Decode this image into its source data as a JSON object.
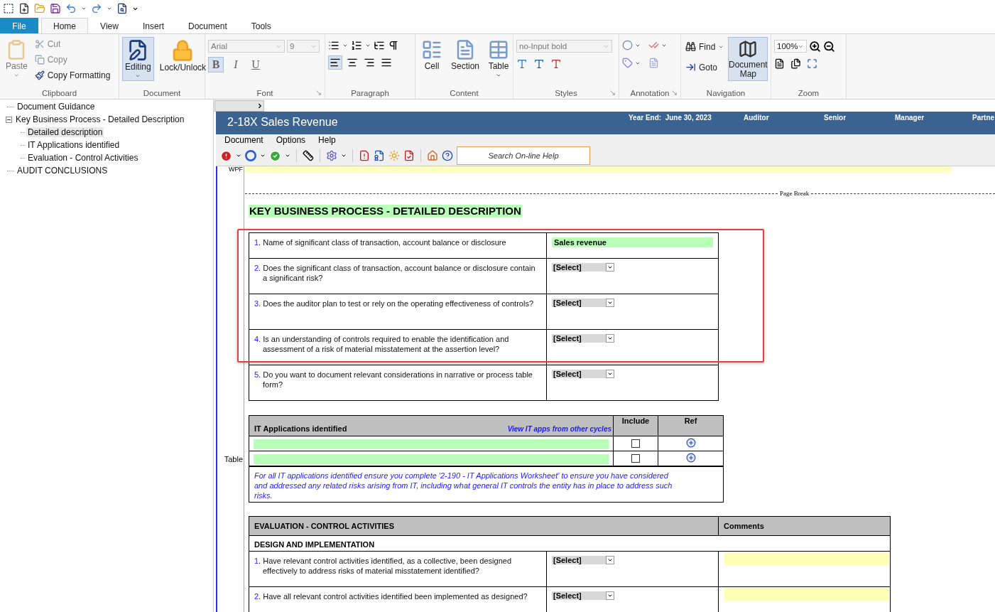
{
  "ribbon_tabs": [
    {
      "label": "File",
      "kind": "file",
      "selected": false
    },
    {
      "label": "Home",
      "kind": "tab",
      "selected": true
    },
    {
      "label": "View",
      "kind": "tab",
      "selected": false
    },
    {
      "label": "Insert",
      "kind": "tab",
      "selected": false
    },
    {
      "label": "Document",
      "kind": "tab",
      "selected": false
    },
    {
      "label": "Tools",
      "kind": "tab",
      "selected": false
    }
  ],
  "clipboard": {
    "label": "Clipboard",
    "paste": {
      "label": "Paste",
      "disabled": true
    },
    "cut": {
      "label": "Cut",
      "disabled": true
    },
    "copy": {
      "label": "Copy",
      "disabled": true
    },
    "copy_formatting": {
      "label": "Copy Formatting",
      "disabled": false
    }
  },
  "document_group": {
    "label": "Document",
    "editing": {
      "label": "Editing",
      "selected": true
    },
    "lock": {
      "label": "Lock/Unlock",
      "selected": false
    }
  },
  "font": {
    "label": "Font",
    "name": {
      "value": "Arial",
      "disabled": true
    },
    "size": {
      "value": "9",
      "disabled": true
    },
    "bold": {
      "label": "B",
      "selected": true
    },
    "italic": {
      "label": "I",
      "selected": false
    },
    "underline": {
      "label": "U",
      "selected": false
    }
  },
  "paragraph": {
    "label": "Paragraph",
    "alignments": [
      {
        "selected": true
      },
      {
        "selected": false
      },
      {
        "selected": false
      },
      {
        "selected": false
      }
    ]
  },
  "content": {
    "label": "Content",
    "buttons": [
      "Cell",
      "Section",
      "Table"
    ]
  },
  "styles": {
    "label": "Styles",
    "style": {
      "value": "no-Input bold",
      "disabled": true
    }
  },
  "annotation": {
    "label": "Annotation"
  },
  "navigation": {
    "label": "Navigation",
    "find": "Find",
    "goto": "Goto",
    "document_map": {
      "label": "Document Map",
      "selected": true
    }
  },
  "zoom": {
    "label": "Zoom",
    "value": "100%"
  },
  "tree": [
    {
      "label": "Document Guidance",
      "selected": false
    },
    {
      "label": "Key Business Process - Detailed Description",
      "selected": false,
      "expanded": true,
      "children": [
        {
          "label": "Detailed description",
          "selected": true
        },
        {
          "label": "IT Applications identified",
          "selected": false
        },
        {
          "label": "Evaluation - Control Activities",
          "selected": false
        }
      ]
    },
    {
      "label": "AUDIT CONCLUSIONS",
      "selected": false
    }
  ],
  "form": {
    "title": "2-18X Sales Revenue",
    "year_end": "Year End:  June 30, 2023",
    "signoffs": [
      "Auditor",
      "Senior",
      "Manager",
      "Partne"
    ],
    "menu": [
      "Document",
      "Options",
      "Help"
    ],
    "search": {
      "placeholder": "Search On-line Help"
    }
  },
  "document": {
    "margin_label": "WPF",
    "page_break": "Page Break",
    "heading": "KEY BUSINESS PROCESS - DETAILED DESCRIPTION",
    "questions": [
      {
        "number": "1.",
        "text": "Name of significant class of transaction, account balance or disclosure",
        "kind": "text",
        "value": "Sales revenue",
        "highlighted": true
      },
      {
        "number": "2.",
        "text": "Does the significant class of transaction, account balance or disclosure contain a significant risk?",
        "kind": "select",
        "value": "[Select]",
        "highlighted": true
      },
      {
        "number": "3.",
        "text": "Does the auditor plan to test or rely on the operating effectiveness of controls?",
        "kind": "select",
        "value": "[Select]",
        "highlighted": true
      },
      {
        "number": "4.",
        "text": "Is an understanding of controls required to enable the identification and assessment of a risk of material misstatement at the assertion level?",
        "kind": "select",
        "value": "[Select]",
        "highlighted": true
      },
      {
        "number": "5.",
        "text": "Do you want to document relevant considerations in narrative or process table form?",
        "kind": "select",
        "value": "[Select]",
        "highlighted": false
      }
    ],
    "it_applications": {
      "margin_label": "Table",
      "title": "IT Applications identified",
      "link": "View IT apps from other cycles",
      "columns": [
        "Include",
        "Ref"
      ],
      "rows": [
        {
          "included": false
        },
        {
          "included": false
        }
      ],
      "note": "For all IT applications identified ensure you complete '2-190 - IT Applications Worksheet' to ensure you have considered and addressed any related risks arising from IT, including what general IT controls the entity has in place to address such risks."
    },
    "evaluation": {
      "title": "EVALUATION - CONTROL ACTIVITIES",
      "comments": "Comments",
      "subheading": "DESIGN AND IMPLEMENTATION",
      "rows": [
        {
          "number": "1.",
          "text": "Have relevant control activities identified, as a collective, been designed effectively to address risks of material misstatement identified?",
          "value": "[Select]"
        },
        {
          "number": "2.",
          "text": "Have all relevant control activities identified been implemented as designed?",
          "value": "[Select]"
        }
      ]
    }
  }
}
